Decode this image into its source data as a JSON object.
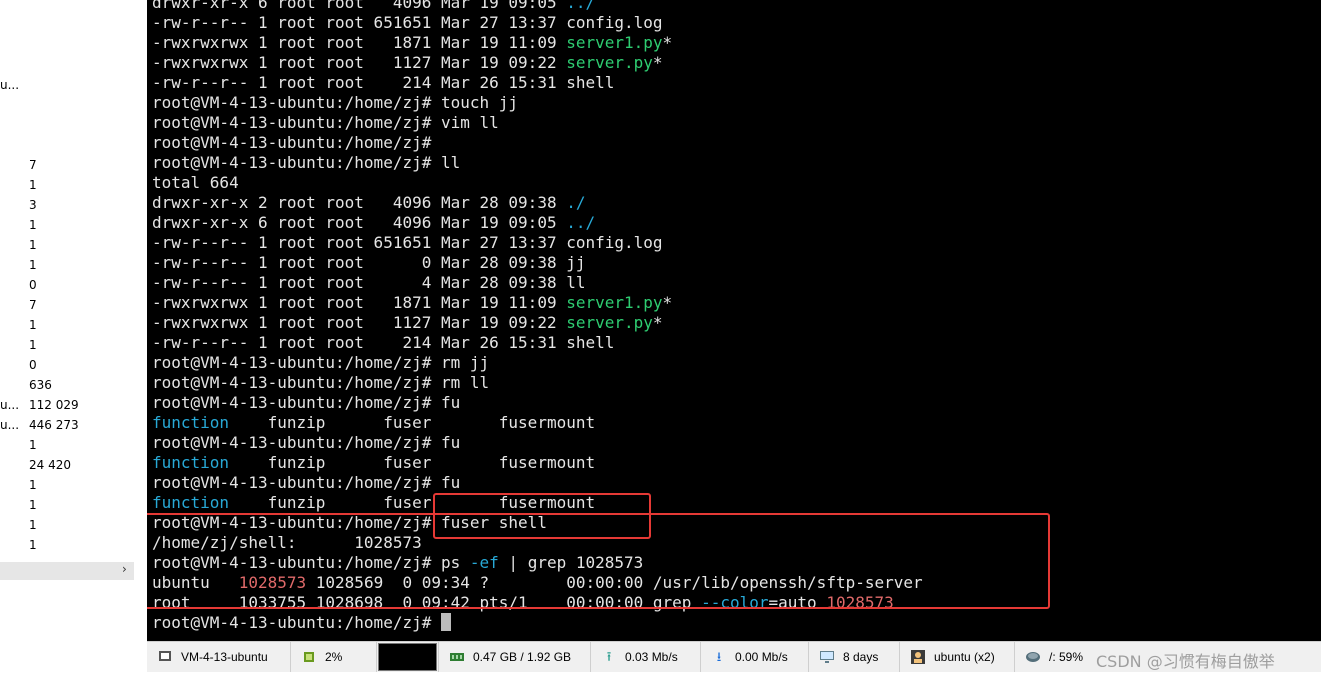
{
  "left_panel": {
    "truncated_labels": [
      {
        "text": "u...",
        "row": 85
      },
      {
        "text": "u...",
        "row": 405
      },
      {
        "text": "u...",
        "row": 425
      }
    ],
    "values": [
      "7",
      "1",
      "3",
      "1",
      "1",
      "1",
      "0",
      "7",
      "1",
      "1",
      "0",
      "636",
      "112 029",
      "446 273",
      "1",
      "24 420",
      "1",
      "1",
      "1",
      "1"
    ],
    "expand_arrow": "›"
  },
  "terminal": {
    "prompt": "root@VM-4-13-ubuntu:/home/zj#",
    "lines": [
      [
        {
          "t": "drwxr-xr-x 6 root root   4096 Mar 19 09:05 "
        },
        {
          "t": "../",
          "c": "blue"
        }
      ],
      [
        {
          "t": "-rw-r--r-- 1 root root 651651 Mar 27 13:37 config.log"
        }
      ],
      [
        {
          "t": "-rwxrwxrwx 1 root root   1871 Mar 19 11:09 "
        },
        {
          "t": "server1.py",
          "c": "green"
        },
        {
          "t": "*"
        }
      ],
      [
        {
          "t": "-rwxrwxrwx 1 root root   1127 Mar 19 09:22 "
        },
        {
          "t": "server.py",
          "c": "green"
        },
        {
          "t": "*"
        }
      ],
      [
        {
          "t": "-rw-r--r-- 1 root root    214 Mar 26 15:31 shell"
        }
      ],
      [
        {
          "t": "root@VM-4-13-ubuntu:/home/zj# touch jj"
        }
      ],
      [
        {
          "t": "root@VM-4-13-ubuntu:/home/zj# vim ll"
        }
      ],
      [
        {
          "t": "root@VM-4-13-ubuntu:/home/zj#"
        }
      ],
      [
        {
          "t": "root@VM-4-13-ubuntu:/home/zj# ll"
        }
      ],
      [
        {
          "t": "total 664"
        }
      ],
      [
        {
          "t": "drwxr-xr-x 2 root root   4096 Mar 28 09:38 "
        },
        {
          "t": "./",
          "c": "blue"
        }
      ],
      [
        {
          "t": "drwxr-xr-x 6 root root   4096 Mar 19 09:05 "
        },
        {
          "t": "../",
          "c": "blue"
        }
      ],
      [
        {
          "t": "-rw-r--r-- 1 root root 651651 Mar 27 13:37 config.log"
        }
      ],
      [
        {
          "t": "-rw-r--r-- 1 root root      0 Mar 28 09:38 jj"
        }
      ],
      [
        {
          "t": "-rw-r--r-- 1 root root      4 Mar 28 09:38 ll"
        }
      ],
      [
        {
          "t": "-rwxrwxrwx 1 root root   1871 Mar 19 11:09 "
        },
        {
          "t": "server1.py",
          "c": "green"
        },
        {
          "t": "*"
        }
      ],
      [
        {
          "t": "-rwxrwxrwx 1 root root   1127 Mar 19 09:22 "
        },
        {
          "t": "server.py",
          "c": "green"
        },
        {
          "t": "*"
        }
      ],
      [
        {
          "t": "-rw-r--r-- 1 root root    214 Mar 26 15:31 shell"
        }
      ],
      [
        {
          "t": "root@VM-4-13-ubuntu:/home/zj# rm jj"
        }
      ],
      [
        {
          "t": "root@VM-4-13-ubuntu:/home/zj# rm ll"
        }
      ],
      [
        {
          "t": "root@VM-4-13-ubuntu:/home/zj# fu"
        }
      ],
      [
        {
          "t": "function",
          "c": "blue"
        },
        {
          "t": "    funzip      fuser       fusermount"
        }
      ],
      [
        {
          "t": "root@VM-4-13-ubuntu:/home/zj# fu"
        }
      ],
      [
        {
          "t": "function",
          "c": "blue"
        },
        {
          "t": "    funzip      fuser       fusermount"
        }
      ],
      [
        {
          "t": "root@VM-4-13-ubuntu:/home/zj# fu"
        }
      ],
      [
        {
          "t": "function",
          "c": "blue"
        },
        {
          "t": "    funzip      fuser       fusermount"
        }
      ],
      [
        {
          "t": "root@VM-4-13-ubuntu:/home/zj# fuser shell"
        }
      ],
      [
        {
          "t": "/home/zj/shell:      1028573"
        }
      ],
      [
        {
          "t": "root@VM-4-13-ubuntu:/home/zj# ps "
        },
        {
          "t": "-ef",
          "c": "blue"
        },
        {
          "t": " | grep 1028573"
        }
      ],
      [
        {
          "t": "ubuntu   "
        },
        {
          "t": "1028573",
          "c": "red"
        },
        {
          "t": " 1028569  0 09:34 ?        00:00:00 /usr/lib/openssh/sftp-server"
        }
      ],
      [
        {
          "t": "root     1033755 1028698  0 09:42 pts/1    00:00:00 grep "
        },
        {
          "t": "--color",
          "c": "blue"
        },
        {
          "t": "=auto "
        },
        {
          "t": "1028573",
          "c": "red"
        }
      ]
    ]
  },
  "statusbar": {
    "session": "VM-4-13-ubuntu",
    "cpu": "2%",
    "memory": "0.47 GB / 1.92 GB",
    "upload": "0.03 Mb/s",
    "download": "0.00 Mb/s",
    "uptime": "8 days",
    "users": "ubuntu (x2)",
    "disk": "/: 59%"
  },
  "watermark": "CSDN @习惯有梅自傲举",
  "colors": {
    "green": "#2ecc71",
    "blue": "#28a9d6",
    "red": "#e06a6a",
    "highlight": "#e53935"
  }
}
